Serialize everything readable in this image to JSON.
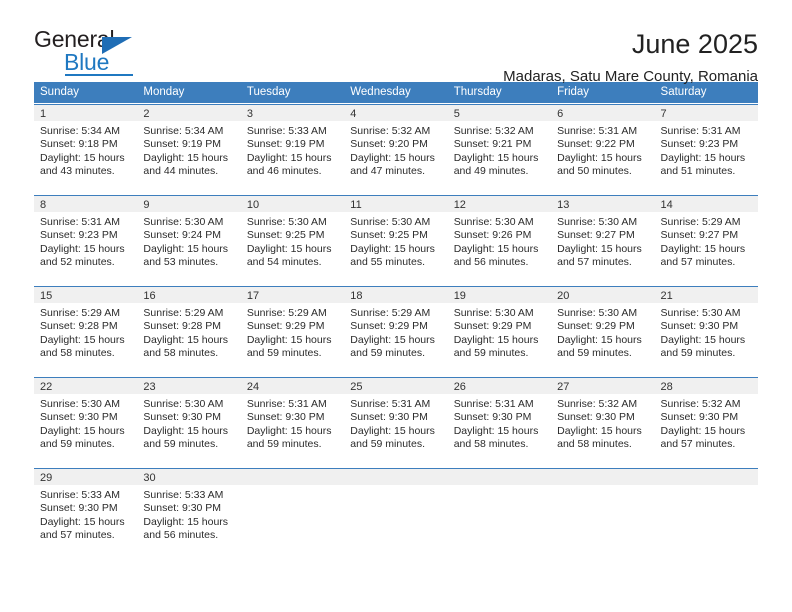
{
  "brand": {
    "name_top": "General",
    "name_bottom": "Blue",
    "accent_color": "#1f78c1",
    "flag_icon": "triangle-flag-icon"
  },
  "header": {
    "title": "June 2025",
    "subtitle": "Madaras, Satu Mare County, Romania"
  },
  "calendar": {
    "header_bg": "#3d7ebd",
    "weekdays": [
      "Sunday",
      "Monday",
      "Tuesday",
      "Wednesday",
      "Thursday",
      "Friday",
      "Saturday"
    ],
    "weeks": [
      [
        {
          "day": "1",
          "sunrise": "Sunrise: 5:34 AM",
          "sunset": "Sunset: 9:18 PM",
          "daylight1": "Daylight: 15 hours",
          "daylight2": "and 43 minutes."
        },
        {
          "day": "2",
          "sunrise": "Sunrise: 5:34 AM",
          "sunset": "Sunset: 9:19 PM",
          "daylight1": "Daylight: 15 hours",
          "daylight2": "and 44 minutes."
        },
        {
          "day": "3",
          "sunrise": "Sunrise: 5:33 AM",
          "sunset": "Sunset: 9:19 PM",
          "daylight1": "Daylight: 15 hours",
          "daylight2": "and 46 minutes."
        },
        {
          "day": "4",
          "sunrise": "Sunrise: 5:32 AM",
          "sunset": "Sunset: 9:20 PM",
          "daylight1": "Daylight: 15 hours",
          "daylight2": "and 47 minutes."
        },
        {
          "day": "5",
          "sunrise": "Sunrise: 5:32 AM",
          "sunset": "Sunset: 9:21 PM",
          "daylight1": "Daylight: 15 hours",
          "daylight2": "and 49 minutes."
        },
        {
          "day": "6",
          "sunrise": "Sunrise: 5:31 AM",
          "sunset": "Sunset: 9:22 PM",
          "daylight1": "Daylight: 15 hours",
          "daylight2": "and 50 minutes."
        },
        {
          "day": "7",
          "sunrise": "Sunrise: 5:31 AM",
          "sunset": "Sunset: 9:23 PM",
          "daylight1": "Daylight: 15 hours",
          "daylight2": "and 51 minutes."
        }
      ],
      [
        {
          "day": "8",
          "sunrise": "Sunrise: 5:31 AM",
          "sunset": "Sunset: 9:23 PM",
          "daylight1": "Daylight: 15 hours",
          "daylight2": "and 52 minutes."
        },
        {
          "day": "9",
          "sunrise": "Sunrise: 5:30 AM",
          "sunset": "Sunset: 9:24 PM",
          "daylight1": "Daylight: 15 hours",
          "daylight2": "and 53 minutes."
        },
        {
          "day": "10",
          "sunrise": "Sunrise: 5:30 AM",
          "sunset": "Sunset: 9:25 PM",
          "daylight1": "Daylight: 15 hours",
          "daylight2": "and 54 minutes."
        },
        {
          "day": "11",
          "sunrise": "Sunrise: 5:30 AM",
          "sunset": "Sunset: 9:25 PM",
          "daylight1": "Daylight: 15 hours",
          "daylight2": "and 55 minutes."
        },
        {
          "day": "12",
          "sunrise": "Sunrise: 5:30 AM",
          "sunset": "Sunset: 9:26 PM",
          "daylight1": "Daylight: 15 hours",
          "daylight2": "and 56 minutes."
        },
        {
          "day": "13",
          "sunrise": "Sunrise: 5:30 AM",
          "sunset": "Sunset: 9:27 PM",
          "daylight1": "Daylight: 15 hours",
          "daylight2": "and 57 minutes."
        },
        {
          "day": "14",
          "sunrise": "Sunrise: 5:29 AM",
          "sunset": "Sunset: 9:27 PM",
          "daylight1": "Daylight: 15 hours",
          "daylight2": "and 57 minutes."
        }
      ],
      [
        {
          "day": "15",
          "sunrise": "Sunrise: 5:29 AM",
          "sunset": "Sunset: 9:28 PM",
          "daylight1": "Daylight: 15 hours",
          "daylight2": "and 58 minutes."
        },
        {
          "day": "16",
          "sunrise": "Sunrise: 5:29 AM",
          "sunset": "Sunset: 9:28 PM",
          "daylight1": "Daylight: 15 hours",
          "daylight2": "and 58 minutes."
        },
        {
          "day": "17",
          "sunrise": "Sunrise: 5:29 AM",
          "sunset": "Sunset: 9:29 PM",
          "daylight1": "Daylight: 15 hours",
          "daylight2": "and 59 minutes."
        },
        {
          "day": "18",
          "sunrise": "Sunrise: 5:29 AM",
          "sunset": "Sunset: 9:29 PM",
          "daylight1": "Daylight: 15 hours",
          "daylight2": "and 59 minutes."
        },
        {
          "day": "19",
          "sunrise": "Sunrise: 5:30 AM",
          "sunset": "Sunset: 9:29 PM",
          "daylight1": "Daylight: 15 hours",
          "daylight2": "and 59 minutes."
        },
        {
          "day": "20",
          "sunrise": "Sunrise: 5:30 AM",
          "sunset": "Sunset: 9:29 PM",
          "daylight1": "Daylight: 15 hours",
          "daylight2": "and 59 minutes."
        },
        {
          "day": "21",
          "sunrise": "Sunrise: 5:30 AM",
          "sunset": "Sunset: 9:30 PM",
          "daylight1": "Daylight: 15 hours",
          "daylight2": "and 59 minutes."
        }
      ],
      [
        {
          "day": "22",
          "sunrise": "Sunrise: 5:30 AM",
          "sunset": "Sunset: 9:30 PM",
          "daylight1": "Daylight: 15 hours",
          "daylight2": "and 59 minutes."
        },
        {
          "day": "23",
          "sunrise": "Sunrise: 5:30 AM",
          "sunset": "Sunset: 9:30 PM",
          "daylight1": "Daylight: 15 hours",
          "daylight2": "and 59 minutes."
        },
        {
          "day": "24",
          "sunrise": "Sunrise: 5:31 AM",
          "sunset": "Sunset: 9:30 PM",
          "daylight1": "Daylight: 15 hours",
          "daylight2": "and 59 minutes."
        },
        {
          "day": "25",
          "sunrise": "Sunrise: 5:31 AM",
          "sunset": "Sunset: 9:30 PM",
          "daylight1": "Daylight: 15 hours",
          "daylight2": "and 59 minutes."
        },
        {
          "day": "26",
          "sunrise": "Sunrise: 5:31 AM",
          "sunset": "Sunset: 9:30 PM",
          "daylight1": "Daylight: 15 hours",
          "daylight2": "and 58 minutes."
        },
        {
          "day": "27",
          "sunrise": "Sunrise: 5:32 AM",
          "sunset": "Sunset: 9:30 PM",
          "daylight1": "Daylight: 15 hours",
          "daylight2": "and 58 minutes."
        },
        {
          "day": "28",
          "sunrise": "Sunrise: 5:32 AM",
          "sunset": "Sunset: 9:30 PM",
          "daylight1": "Daylight: 15 hours",
          "daylight2": "and 57 minutes."
        }
      ],
      [
        {
          "day": "29",
          "sunrise": "Sunrise: 5:33 AM",
          "sunset": "Sunset: 9:30 PM",
          "daylight1": "Daylight: 15 hours",
          "daylight2": "and 57 minutes."
        },
        {
          "day": "30",
          "sunrise": "Sunrise: 5:33 AM",
          "sunset": "Sunset: 9:30 PM",
          "daylight1": "Daylight: 15 hours",
          "daylight2": "and 56 minutes."
        },
        {
          "day": "",
          "sunrise": "",
          "sunset": "",
          "daylight1": "",
          "daylight2": ""
        },
        {
          "day": "",
          "sunrise": "",
          "sunset": "",
          "daylight1": "",
          "daylight2": ""
        },
        {
          "day": "",
          "sunrise": "",
          "sunset": "",
          "daylight1": "",
          "daylight2": ""
        },
        {
          "day": "",
          "sunrise": "",
          "sunset": "",
          "daylight1": "",
          "daylight2": ""
        },
        {
          "day": "",
          "sunrise": "",
          "sunset": "",
          "daylight1": "",
          "daylight2": ""
        }
      ]
    ]
  }
}
